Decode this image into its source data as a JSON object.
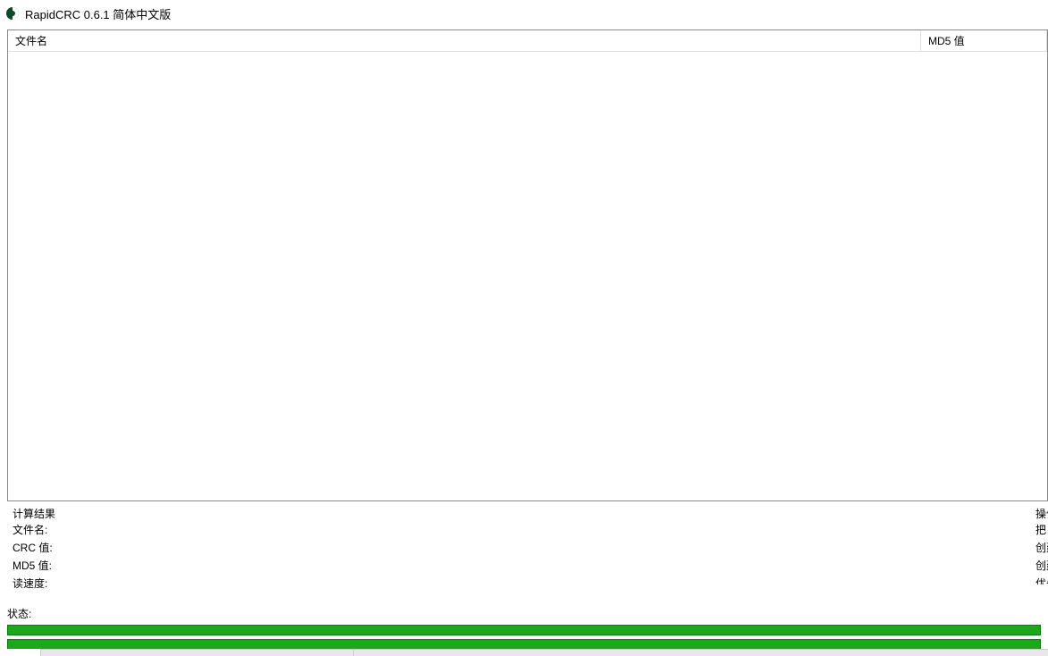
{
  "window": {
    "title": "RapidCRC 0.6.1 简体中文版"
  },
  "list": {
    "columns": {
      "filename": "文件名",
      "md5": "MD5 值"
    }
  },
  "results": {
    "legend": "计算结果",
    "filename_label": "文件名:",
    "crc_label": "CRC 值:",
    "md5_label": "MD5 值:",
    "readspeed_label": "读速度:"
  },
  "actions": {
    "legend": "操作",
    "put_crc": "把 C",
    "create_sfv": "创建",
    "create_md5": "创建",
    "options": "优先"
  },
  "status": {
    "label": "状态:"
  }
}
